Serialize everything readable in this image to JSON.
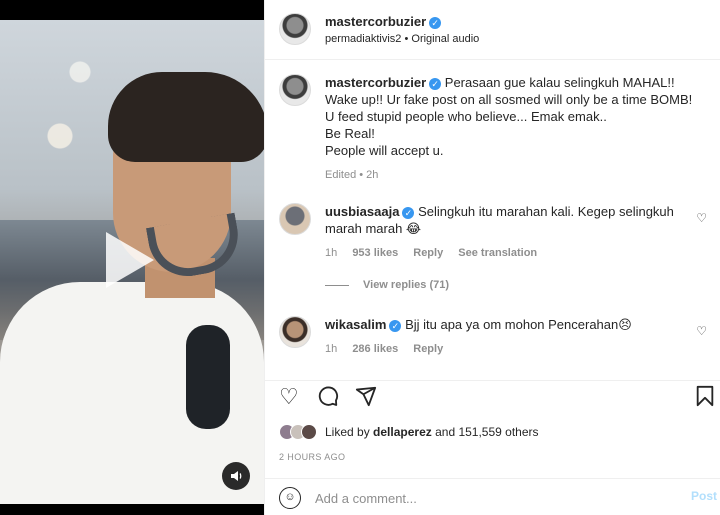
{
  "post": {
    "author": "mastercorbuzier",
    "subtitle": "permadiaktivis2 • Original audio",
    "caption_user": "mastercorbuzier",
    "caption_lines": [
      "Perasaan gue kalau selingkuh MAHAL!!",
      "Wake up!! Ur fake post on all sosmed will only be a time BOMB!",
      "U feed stupid people who believe... Emak emak..",
      "Be Real!",
      "People will accept u."
    ],
    "caption_meta": "Edited • 2h"
  },
  "comments": [
    {
      "user": "uusbiasaaja",
      "text": "Selingkuh itu marahan kali. Kegep selingkuh marah marah 😂",
      "time": "1h",
      "likes": "953 likes",
      "reply": "Reply",
      "translate": "See translation"
    },
    {
      "user": "wikasalim",
      "text": "Bjj itu apa ya om mohon Pencerahan😣",
      "time": "1h",
      "likes": "286 likes",
      "reply": "Reply"
    }
  ],
  "view_replies": "View replies (71)",
  "likes": {
    "prefix": "Liked by",
    "user": "dellaperez",
    "suffix": "and 151,559 others"
  },
  "date": "2 HOURS AGO",
  "add_comment": {
    "placeholder": "Add a comment...",
    "post_label": "Post"
  },
  "icons": {
    "play": "play-icon",
    "sound": "sound-icon",
    "heart": "heart-icon",
    "comment": "comment-icon",
    "share": "share-icon",
    "save": "bookmark-icon",
    "emoji": "emoji-icon"
  },
  "colors": {
    "verified": "#3897f0",
    "post_button": "#b2dffc",
    "muted": "#8e8e8e"
  }
}
